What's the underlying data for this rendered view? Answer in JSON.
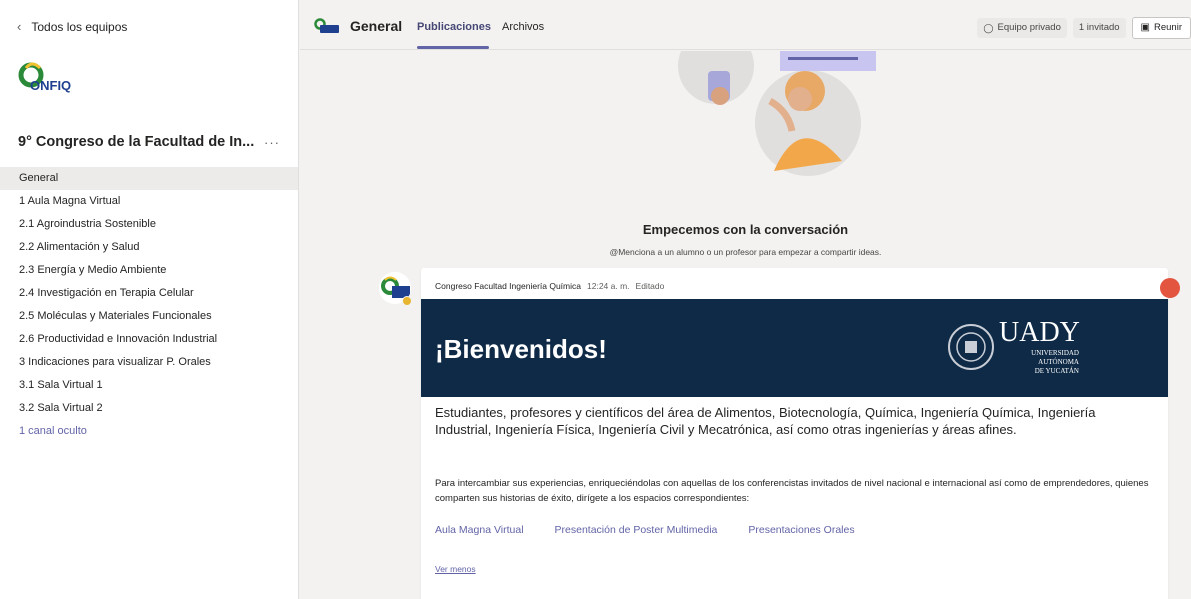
{
  "sidebar": {
    "back_label": "Todos los equipos",
    "team_logo_text": "ONFIQ",
    "team_name": "9° Congreso de la Facultad de In...",
    "more_label": "···",
    "channels": [
      "General",
      "1 Aula Magna Virtual",
      "2.1 Agroindustria Sostenible",
      "2.2 Alimentación y Salud",
      "2.3 Energía y Medio Ambiente",
      "2.4 Investigación en Terapia Celular",
      "2.5 Moléculas y Materiales Funcionales",
      "2.6 Productividad e Innovación Industrial",
      "3 Indicaciones para visualizar P. Orales",
      "3.1 Sala Virtual 1",
      "3.2 Sala Virtual 2"
    ],
    "hidden_channels": "1 canal oculto"
  },
  "header": {
    "channel_title": "General",
    "tabs": [
      "Publicaciones",
      "Archivos"
    ],
    "private_team": "Equipo privado",
    "guests": "1 invitado",
    "meet": "Reunir"
  },
  "main": {
    "empty_title": "Empecemos con la conversación",
    "empty_subtitle": "@Menciona a un alumno o un profesor para empezar a compartir ideas.",
    "post": {
      "author": "Congreso Facultad Ingeniería Química",
      "time": "12:24 a. m.",
      "edited": "Editado",
      "banner_title": "¡Bienvenidos!",
      "uady_name": "UADY",
      "uady_line1": "UNIVERSIDAD",
      "uady_line2": "AUTÓNOMA",
      "uady_line3": "DE YUCATÁN",
      "lead": "Estudiantes, profesores y científicos del área de Alimentos, Biotecnología, Química, Ingeniería Química, Ingeniería Industrial, Ingeniería Física, Ingeniería Civil y Mecatrónica, así como otras ingenierías y áreas afines.",
      "body": "Para intercambiar sus experiencias, enriqueciéndolas con aquellas de los conferencistas invitados de nivel nacional e internacional así como de emprendedores, quienes comparten sus historias de éxito, dirígete a los espacios correspondientes:",
      "links": [
        "Aula Magna Virtual",
        "Presentación de Poster Multimedia",
        "Presentaciones Orales"
      ],
      "see_less": "Ver menos"
    }
  },
  "colors": {
    "accent": "#6264a7",
    "banner": "#0e2a47",
    "reaction": "#e3553e",
    "presence": "#e8b531"
  }
}
